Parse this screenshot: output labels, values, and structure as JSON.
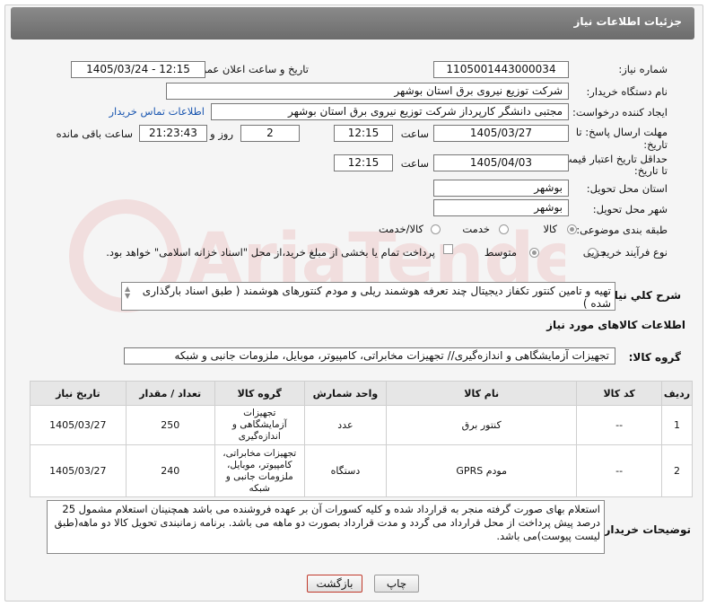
{
  "header": {
    "title": "جزئیات اطلاعات نیاز"
  },
  "fields": {
    "need_number": {
      "label": "شماره نیاز:",
      "value": "1105001443000034"
    },
    "announce": {
      "label": "تاریخ و ساعت اعلان عمومی:",
      "value": "1405/03/24 - 12:15"
    },
    "buyer_org": {
      "label": "نام دستگاه خریدار:",
      "value": "شرکت توزیع نیروی برق استان بوشهر"
    },
    "creator": {
      "label": "ایجاد کننده درخواست:",
      "value": "مجتبی دانشگر کارپرداز شرکت توزیع نیروی برق استان بوشهر",
      "contact_link": "اطلاعات تماس خریدار"
    },
    "reply_deadline": {
      "label1": "مهلت ارسال پاسخ: تا",
      "label2": "تاریخ:",
      "date": "1405/03/27",
      "time_label": "ساعت",
      "time": "12:15",
      "days": "2",
      "days_label": "روز و",
      "remaining": "21:23:43",
      "remaining_label": "ساعت باقی مانده"
    },
    "price_validity": {
      "label1": "حداقل تاریخ اعتبار قیمت:",
      "label2": "تا تاریخ:",
      "date": "1405/04/03",
      "time_label": "ساعت",
      "time": "12:15"
    },
    "province": {
      "label": "استان محل تحویل:",
      "value": "بوشهر"
    },
    "city": {
      "label": "شهر محل تحویل:",
      "value": "بوشهر"
    },
    "category": {
      "label": "طبقه بندی موضوعی:",
      "options": [
        "کالا",
        "خدمت",
        "کالا/خدمت"
      ],
      "selected": "کالا"
    },
    "purchase_type": {
      "label": "نوع فرآیند خرید :",
      "options": [
        "جزیی",
        "متوسط"
      ],
      "selected": "متوسط",
      "payment_note": "پرداخت تمام یا بخشی از مبلغ خرید،از محل \"اسناد خزانه اسلامی\" خواهد بود."
    }
  },
  "description": {
    "label": "شرح کلي نياز:",
    "text": "تهیه و تامین کنتور تکفاز دیجیتال چند تعرفه هوشمند ریلی و مودم کنتورهای هوشمند ( طبق اسناد بارگذاری شده )"
  },
  "goods_section": {
    "title": "اطلاعات کالاهای مورد نیاز",
    "group_label": "گروه کالا:",
    "group_value": "تجهیزات آزمایشگاهی و اندازه‌گیری// تجهیزات مخابراتی، کامپیوتر، موبایل، ملزومات جانبی و شبکه"
  },
  "table": {
    "headers": [
      "ردیف",
      "کد کالا",
      "نام کالا",
      "واحد شمارش",
      "گروه کالا",
      "تعداد / مقدار",
      "تاریخ نیاز"
    ],
    "rows": [
      {
        "row": "1",
        "code": "--",
        "name": "کنتور برق",
        "unit": "عدد",
        "group": "تجهیزات آزمایشگاهی و اندازه‌گیری",
        "qty": "250",
        "date": "1405/03/27"
      },
      {
        "row": "2",
        "code": "--",
        "name": "مودم GPRS",
        "unit": "دستگاه",
        "group": "تجهیزات مخابراتی، کامپیوتر، موبایل، ملزومات جانبی و شبکه",
        "qty": "240",
        "date": "1405/03/27"
      }
    ]
  },
  "buyer_notes": {
    "label": "توضیحات خریدار:",
    "text": "استعلام بهای صورت گرفته منجر به قرارداد شده و کلیه کسورات آن بر عهده فروشنده می باشد همچنینان استعلام مشمول 25 درصد پیش پرداخت از محل قرارداد می گردد و مدت قرارداد بصورت دو ماهه می باشد. برنامه زمانبندی تحویل کالا دو ماهه(طبق لیست پیوست)می باشد."
  },
  "buttons": {
    "print": "چاپ",
    "back": "بازگشت"
  },
  "watermark": {
    "text": "AriaTender.net"
  },
  "colors": {
    "header": "#7a7a7a",
    "link": "#1a56b0",
    "back_border": "#c0392b"
  }
}
